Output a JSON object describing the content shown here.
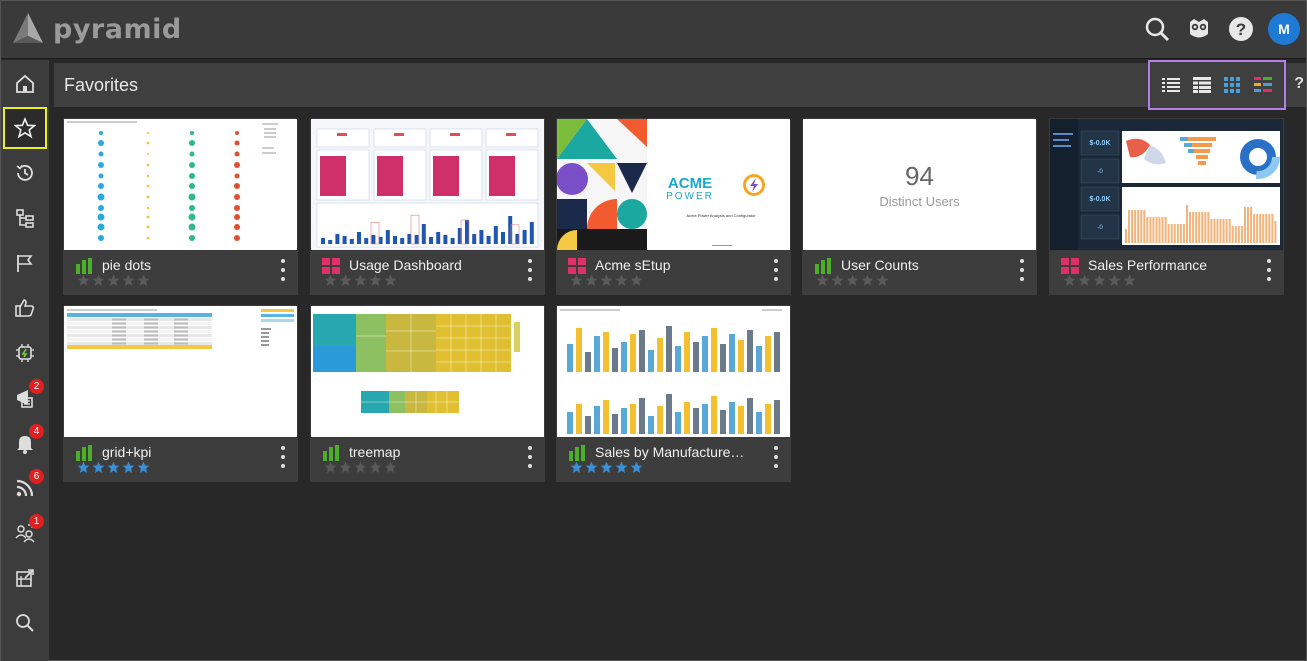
{
  "app": {
    "logo_text": "pyramid",
    "avatar_initial": "M"
  },
  "page": {
    "title": "Favorites",
    "help": "?"
  },
  "sidebar": {
    "items": [
      {
        "name": "home-icon"
      },
      {
        "name": "star-icon",
        "active": true
      },
      {
        "name": "history-icon"
      },
      {
        "name": "hierarchy-icon"
      },
      {
        "name": "flag-icon"
      },
      {
        "name": "thumbs-up-icon"
      },
      {
        "name": "chip-icon"
      },
      {
        "name": "publish-icon",
        "badge": "2"
      },
      {
        "name": "bell-icon",
        "badge": "4"
      },
      {
        "name": "rss-icon",
        "badge": "6"
      },
      {
        "name": "users-icon",
        "badge": "1"
      },
      {
        "name": "export-icon"
      },
      {
        "name": "search-icon"
      }
    ]
  },
  "cards": [
    {
      "title": "pie dots",
      "type": "chart",
      "stars_filled": 0
    },
    {
      "title": "Usage Dashboard",
      "type": "dashboard",
      "stars_filled": 0
    },
    {
      "title": "Acme sEtup",
      "type": "dashboard",
      "stars_filled": 0
    },
    {
      "title": "User Counts",
      "type": "chart",
      "stars_filled": 0,
      "kpi_value": "94",
      "kpi_label": "Distinct Users"
    },
    {
      "title": "Sales Performance",
      "type": "dashboard",
      "stars_filled": 0
    },
    {
      "title": "grid+kpi",
      "type": "chart",
      "stars_filled": 5
    },
    {
      "title": "treemap",
      "type": "chart",
      "stars_filled": 0
    },
    {
      "title": "Sales by Manufacturer a...",
      "type": "chart",
      "stars_filled": 5
    }
  ],
  "thumb_text": {
    "acme_logo_1": "ACME",
    "acme_logo_2": "POWER",
    "acme_subtitle": "Acme Power Analysis and Configurator",
    "sales_kpi_1": "$-0.0K",
    "sales_kpi_2": "$-0.0K",
    "sales_kpi_3": "-0",
    "sales_kpi_4": "-0"
  },
  "colors": {
    "accent_yellow": "#e8ef2a",
    "view_box_purple": "#b47ee8",
    "chart_green": "#4caf2a",
    "dashboard_pink": "#e0306a",
    "star_blue": "#3a8fd6",
    "star_gray": "#5a5a5a",
    "badge_red": "#e02020"
  }
}
